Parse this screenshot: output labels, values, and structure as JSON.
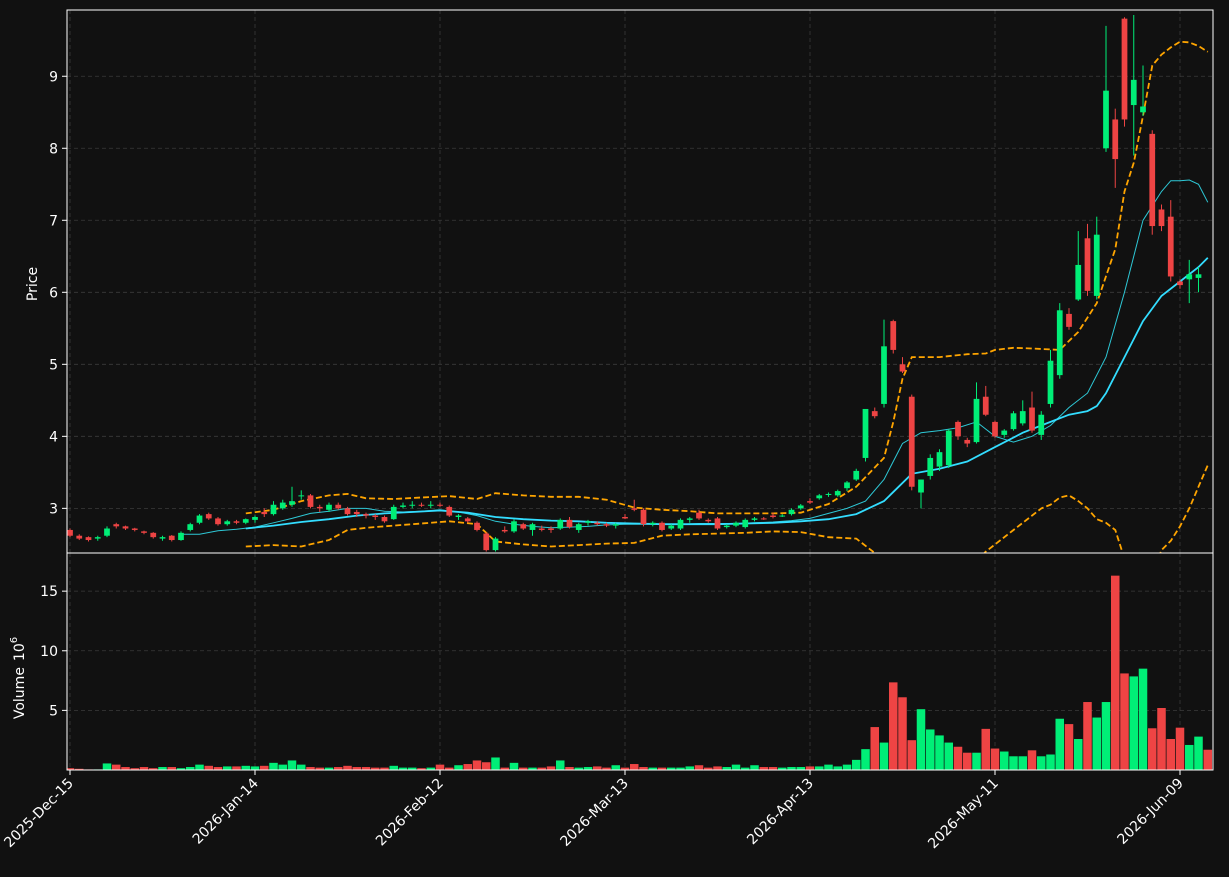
{
  "chart_data": {
    "type": "candlestick",
    "background": "#111111",
    "colors": {
      "up": "#00ee77",
      "down": "#ee4444",
      "ma_fast": "#2ec8d6",
      "ma_slow": "#33ddff",
      "bands": "#ffa500",
      "grid": "#3a3a3a",
      "axis": "#ffffff"
    },
    "grid": true,
    "price_panel": {
      "ylabel": "Price",
      "ylim": [
        2.38,
        9.92
      ],
      "yticks": [
        3,
        4,
        5,
        6,
        7,
        8,
        9
      ]
    },
    "volume_panel": {
      "ylabel": "Volume",
      "ylabel_exp": "10",
      "ylabel_sup": "6",
      "ylim": [
        0,
        18.2
      ],
      "yticks": [
        5,
        10,
        15
      ]
    },
    "x_ticks": [
      {
        "index": 0,
        "label": "2025-Dec-15"
      },
      {
        "index": 20,
        "label": "2026-Jan-14"
      },
      {
        "index": 40,
        "label": "2026-Feb-12"
      },
      {
        "index": 60,
        "label": "2026-Mar-13"
      },
      {
        "index": 80,
        "label": "2026-Apr-13"
      },
      {
        "index": 100,
        "label": "2026-May-11"
      },
      {
        "index": 120,
        "label": "2026-Jun-09"
      }
    ],
    "candles": [
      [
        2.7,
        2.72,
        2.6,
        2.62
      ],
      [
        2.62,
        2.64,
        2.56,
        2.58
      ],
      [
        2.6,
        2.61,
        2.54,
        2.56
      ],
      [
        2.58,
        2.62,
        2.55,
        2.6
      ],
      [
        2.62,
        2.75,
        2.6,
        2.72
      ],
      [
        2.78,
        2.8,
        2.72,
        2.75
      ],
      [
        2.75,
        2.76,
        2.7,
        2.72
      ],
      [
        2.72,
        2.73,
        2.68,
        2.7
      ],
      [
        2.68,
        2.69,
        2.64,
        2.66
      ],
      [
        2.66,
        2.67,
        2.58,
        2.6
      ],
      [
        2.58,
        2.62,
        2.55,
        2.6
      ],
      [
        2.62,
        2.63,
        2.54,
        2.56
      ],
      [
        2.56,
        2.68,
        2.55,
        2.66
      ],
      [
        2.7,
        2.8,
        2.68,
        2.78
      ],
      [
        2.8,
        2.92,
        2.78,
        2.9
      ],
      [
        2.92,
        2.94,
        2.84,
        2.86
      ],
      [
        2.86,
        2.88,
        2.76,
        2.78
      ],
      [
        2.78,
        2.84,
        2.76,
        2.82
      ],
      [
        2.82,
        2.84,
        2.78,
        2.8
      ],
      [
        2.8,
        2.86,
        2.78,
        2.85
      ],
      [
        2.84,
        2.9,
        2.8,
        2.88
      ],
      [
        2.95,
        3.0,
        2.88,
        2.92
      ],
      [
        2.92,
        3.1,
        2.9,
        3.05
      ],
      [
        3.0,
        3.12,
        2.98,
        3.08
      ],
      [
        3.05,
        3.3,
        3.02,
        3.1
      ],
      [
        3.18,
        3.25,
        3.12,
        3.18
      ],
      [
        3.18,
        3.2,
        3.0,
        3.02
      ],
      [
        3.02,
        3.05,
        2.95,
        3.0
      ],
      [
        2.98,
        3.08,
        2.95,
        3.05
      ],
      [
        3.05,
        3.08,
        2.98,
        3.0
      ],
      [
        3.0,
        3.02,
        2.9,
        2.92
      ],
      [
        2.95,
        2.98,
        2.88,
        2.92
      ],
      [
        2.92,
        2.94,
        2.86,
        2.9
      ],
      [
        2.9,
        2.92,
        2.84,
        2.88
      ],
      [
        2.88,
        2.9,
        2.8,
        2.82
      ],
      [
        2.85,
        3.05,
        2.84,
        3.02
      ],
      [
        3.02,
        3.08,
        3.0,
        3.04
      ],
      [
        3.04,
        3.1,
        3.0,
        3.05
      ],
      [
        3.05,
        3.08,
        3.02,
        3.04
      ],
      [
        3.04,
        3.1,
        3.0,
        3.05
      ],
      [
        3.05,
        3.08,
        3.02,
        3.04
      ],
      [
        3.02,
        3.04,
        2.88,
        2.9
      ],
      [
        2.88,
        2.92,
        2.84,
        2.9
      ],
      [
        2.86,
        2.88,
        2.8,
        2.82
      ],
      [
        2.8,
        2.82,
        2.68,
        2.7
      ],
      [
        2.65,
        2.67,
        2.4,
        2.42
      ],
      [
        2.42,
        2.6,
        2.4,
        2.58
      ],
      [
        2.7,
        2.75,
        2.66,
        2.68
      ],
      [
        2.68,
        2.85,
        2.66,
        2.82
      ],
      [
        2.78,
        2.8,
        2.7,
        2.72
      ],
      [
        2.7,
        2.8,
        2.62,
        2.78
      ],
      [
        2.72,
        2.76,
        2.68,
        2.7
      ],
      [
        2.72,
        2.75,
        2.66,
        2.7
      ],
      [
        2.72,
        2.86,
        2.7,
        2.84
      ],
      [
        2.84,
        2.88,
        2.72,
        2.74
      ],
      [
        2.7,
        2.8,
        2.66,
        2.78
      ],
      [
        2.8,
        2.84,
        2.76,
        2.82
      ],
      [
        2.8,
        2.82,
        2.76,
        2.78
      ],
      [
        2.78,
        2.8,
        2.74,
        2.76
      ],
      [
        2.76,
        2.8,
        2.72,
        2.78
      ],
      [
        2.88,
        2.92,
        2.85,
        2.86
      ],
      [
        3.0,
        3.12,
        2.96,
        2.98
      ],
      [
        2.98,
        3.0,
        2.75,
        2.78
      ],
      [
        2.78,
        2.82,
        2.75,
        2.8
      ],
      [
        2.8,
        2.82,
        2.68,
        2.7
      ],
      [
        2.72,
        2.78,
        2.7,
        2.76
      ],
      [
        2.72,
        2.86,
        2.7,
        2.84
      ],
      [
        2.84,
        2.88,
        2.8,
        2.86
      ],
      [
        2.94,
        2.98,
        2.84,
        2.86
      ],
      [
        2.84,
        2.86,
        2.8,
        2.82
      ],
      [
        2.86,
        2.88,
        2.7,
        2.72
      ],
      [
        2.74,
        2.78,
        2.72,
        2.76
      ],
      [
        2.76,
        2.82,
        2.74,
        2.8
      ],
      [
        2.74,
        2.86,
        2.72,
        2.84
      ],
      [
        2.84,
        2.88,
        2.82,
        2.86
      ],
      [
        2.86,
        2.88,
        2.84,
        2.85
      ],
      [
        2.9,
        2.94,
        2.86,
        2.88
      ],
      [
        2.9,
        2.92,
        2.88,
        2.9
      ],
      [
        2.92,
        3.0,
        2.9,
        2.98
      ],
      [
        3.0,
        3.06,
        2.98,
        3.04
      ],
      [
        3.1,
        3.14,
        3.06,
        3.08
      ],
      [
        3.14,
        3.2,
        3.12,
        3.18
      ],
      [
        3.2,
        3.22,
        3.16,
        3.2
      ],
      [
        3.18,
        3.26,
        3.16,
        3.24
      ],
      [
        3.28,
        3.38,
        3.24,
        3.36
      ],
      [
        3.4,
        3.55,
        3.38,
        3.52
      ],
      [
        3.7,
        4.38,
        3.65,
        4.38
      ],
      [
        4.35,
        4.4,
        4.25,
        4.28
      ],
      [
        4.45,
        5.62,
        4.4,
        5.25
      ],
      [
        5.6,
        5.62,
        5.15,
        5.2
      ],
      [
        5.0,
        5.1,
        4.88,
        4.9
      ],
      [
        4.55,
        4.58,
        3.25,
        3.3
      ],
      [
        3.22,
        3.4,
        3.0,
        3.4
      ],
      [
        3.45,
        3.75,
        3.4,
        3.7
      ],
      [
        3.58,
        3.82,
        3.52,
        3.78
      ],
      [
        3.6,
        4.1,
        3.56,
        4.08
      ],
      [
        4.2,
        4.22,
        3.95,
        4.0
      ],
      [
        3.95,
        3.98,
        3.85,
        3.9
      ],
      [
        3.92,
        4.75,
        3.9,
        4.52
      ],
      [
        4.55,
        4.7,
        4.28,
        4.3
      ],
      [
        4.2,
        4.22,
        3.98,
        4.0
      ],
      [
        4.02,
        4.1,
        3.98,
        4.08
      ],
      [
        4.1,
        4.35,
        4.08,
        4.32
      ],
      [
        4.18,
        4.5,
        4.15,
        4.35
      ],
      [
        4.4,
        4.62,
        4.05,
        4.08
      ],
      [
        4.02,
        4.35,
        3.95,
        4.3
      ],
      [
        4.45,
        5.2,
        4.4,
        5.05
      ],
      [
        4.85,
        5.85,
        4.8,
        5.75
      ],
      [
        5.7,
        5.78,
        5.48,
        5.52
      ],
      [
        5.9,
        6.85,
        5.88,
        6.38
      ],
      [
        6.75,
        6.95,
        5.95,
        6.02
      ],
      [
        5.95,
        7.05,
        5.9,
        6.8
      ],
      [
        8.0,
        9.7,
        7.95,
        8.8
      ],
      [
        8.4,
        8.55,
        7.45,
        7.85
      ],
      [
        9.8,
        9.82,
        8.3,
        8.4
      ],
      [
        8.6,
        9.85,
        7.9,
        8.95
      ],
      [
        8.5,
        9.15,
        8.45,
        8.58
      ],
      [
        8.2,
        8.25,
        6.8,
        6.92
      ],
      [
        7.15,
        7.22,
        6.85,
        6.92
      ],
      [
        7.05,
        7.28,
        6.15,
        6.22
      ],
      [
        6.15,
        6.18,
        6.05,
        6.1
      ],
      [
        6.18,
        6.45,
        5.85,
        6.25
      ],
      [
        6.2,
        6.35,
        6.0,
        6.25
      ]
    ],
    "volume": [
      0.15,
      0.1,
      0.05,
      0.05,
      0.55,
      0.45,
      0.25,
      0.15,
      0.25,
      0.15,
      0.25,
      0.25,
      0.15,
      0.25,
      0.45,
      0.35,
      0.25,
      0.3,
      0.3,
      0.35,
      0.3,
      0.35,
      0.6,
      0.45,
      0.8,
      0.45,
      0.25,
      0.2,
      0.2,
      0.25,
      0.35,
      0.25,
      0.25,
      0.2,
      0.2,
      0.35,
      0.2,
      0.2,
      0.15,
      0.2,
      0.45,
      0.2,
      0.4,
      0.5,
      0.8,
      0.65,
      1.05,
      0.2,
      0.6,
      0.2,
      0.2,
      0.2,
      0.3,
      0.8,
      0.25,
      0.2,
      0.25,
      0.3,
      0.2,
      0.4,
      0.2,
      0.5,
      0.25,
      0.2,
      0.2,
      0.2,
      0.2,
      0.3,
      0.4,
      0.2,
      0.3,
      0.25,
      0.45,
      0.2,
      0.4,
      0.25,
      0.25,
      0.2,
      0.25,
      0.25,
      0.3,
      0.3,
      0.45,
      0.3,
      0.45,
      0.85,
      1.75,
      3.6,
      2.3,
      7.35,
      6.1,
      2.5,
      5.1,
      3.4,
      2.9,
      2.3,
      1.95,
      1.45,
      1.45,
      3.45,
      1.8,
      1.55,
      1.15,
      1.15,
      1.65,
      1.15,
      1.3,
      4.3,
      3.85,
      2.6,
      5.7,
      4.4,
      5.7,
      16.3,
      8.1,
      7.85,
      8.5,
      3.5,
      5.2,
      2.6,
      3.55,
      2.1,
      2.8,
      1.7
    ],
    "ma_fast": [
      [
        12,
        2.64
      ],
      [
        14,
        2.64
      ],
      [
        16,
        2.69
      ],
      [
        18,
        2.71
      ],
      [
        20,
        2.74
      ],
      [
        22,
        2.8
      ],
      [
        24,
        2.86
      ],
      [
        26,
        2.93
      ],
      [
        28,
        2.96
      ],
      [
        30,
        3.0
      ],
      [
        32,
        3.0
      ],
      [
        34,
        2.96
      ],
      [
        36,
        2.95
      ],
      [
        38,
        2.96
      ],
      [
        40,
        2.98
      ],
      [
        42,
        2.95
      ],
      [
        44,
        2.9
      ],
      [
        46,
        2.82
      ],
      [
        48,
        2.78
      ],
      [
        50,
        2.75
      ],
      [
        52,
        2.73
      ],
      [
        54,
        2.74
      ],
      [
        56,
        2.75
      ],
      [
        58,
        2.77
      ],
      [
        60,
        2.78
      ],
      [
        62,
        2.78
      ],
      [
        64,
        2.78
      ],
      [
        66,
        2.78
      ],
      [
        68,
        2.79
      ],
      [
        70,
        2.79
      ],
      [
        72,
        2.79
      ],
      [
        74,
        2.8
      ],
      [
        76,
        2.81
      ],
      [
        78,
        2.83
      ],
      [
        80,
        2.86
      ],
      [
        82,
        2.93
      ],
      [
        84,
        3.0
      ],
      [
        86,
        3.1
      ],
      [
        88,
        3.4
      ],
      [
        90,
        3.9
      ],
      [
        92,
        4.05
      ],
      [
        94,
        4.08
      ],
      [
        96,
        4.12
      ],
      [
        98,
        4.2
      ],
      [
        100,
        4.0
      ],
      [
        102,
        3.92
      ],
      [
        104,
        4.0
      ],
      [
        106,
        4.15
      ],
      [
        108,
        4.4
      ],
      [
        110,
        4.6
      ],
      [
        112,
        5.1
      ],
      [
        114,
        6.0
      ],
      [
        116,
        7.0
      ],
      [
        118,
        7.4
      ],
      [
        119,
        7.55
      ],
      [
        120,
        7.55
      ],
      [
        121,
        7.56
      ],
      [
        122,
        7.5
      ],
      [
        123,
        7.25
      ]
    ],
    "ma_slow": [
      [
        19,
        2.72
      ],
      [
        22,
        2.76
      ],
      [
        25,
        2.81
      ],
      [
        28,
        2.85
      ],
      [
        31,
        2.9
      ],
      [
        34,
        2.93
      ],
      [
        37,
        2.95
      ],
      [
        40,
        2.97
      ],
      [
        43,
        2.94
      ],
      [
        46,
        2.88
      ],
      [
        49,
        2.85
      ],
      [
        52,
        2.83
      ],
      [
        55,
        2.82
      ],
      [
        58,
        2.8
      ],
      [
        61,
        2.79
      ],
      [
        64,
        2.78
      ],
      [
        67,
        2.78
      ],
      [
        70,
        2.78
      ],
      [
        73,
        2.79
      ],
      [
        76,
        2.8
      ],
      [
        79,
        2.82
      ],
      [
        82,
        2.85
      ],
      [
        85,
        2.92
      ],
      [
        88,
        3.1
      ],
      [
        91,
        3.48
      ],
      [
        94,
        3.55
      ],
      [
        97,
        3.65
      ],
      [
        100,
        3.85
      ],
      [
        103,
        4.05
      ],
      [
        106,
        4.2
      ],
      [
        108,
        4.3
      ],
      [
        110,
        4.35
      ],
      [
        111,
        4.42
      ],
      [
        112,
        4.6
      ],
      [
        114,
        5.1
      ],
      [
        116,
        5.6
      ],
      [
        118,
        5.95
      ],
      [
        120,
        6.15
      ],
      [
        122,
        6.35
      ],
      [
        123,
        6.48
      ]
    ],
    "band_upper": [
      [
        19,
        2.93
      ],
      [
        22,
        2.98
      ],
      [
        25,
        3.1
      ],
      [
        28,
        3.18
      ],
      [
        30,
        3.2
      ],
      [
        32,
        3.14
      ],
      [
        35,
        3.13
      ],
      [
        38,
        3.15
      ],
      [
        41,
        3.17
      ],
      [
        44,
        3.13
      ],
      [
        46,
        3.21
      ],
      [
        49,
        3.18
      ],
      [
        52,
        3.16
      ],
      [
        55,
        3.16
      ],
      [
        58,
        3.12
      ],
      [
        61,
        3.01
      ],
      [
        64,
        2.98
      ],
      [
        67,
        2.96
      ],
      [
        70,
        2.93
      ],
      [
        73,
        2.93
      ],
      [
        76,
        2.93
      ],
      [
        79,
        2.94
      ],
      [
        82,
        3.06
      ],
      [
        85,
        3.3
      ],
      [
        88,
        3.7
      ],
      [
        89,
        4.2
      ],
      [
        90,
        4.8
      ],
      [
        91,
        5.1
      ],
      [
        94,
        5.1
      ],
      [
        97,
        5.14
      ],
      [
        99,
        5.15
      ],
      [
        100,
        5.2
      ],
      [
        102,
        5.23
      ],
      [
        104,
        5.22
      ],
      [
        107,
        5.2
      ],
      [
        109,
        5.45
      ],
      [
        111,
        5.85
      ],
      [
        113,
        6.6
      ],
      [
        114,
        7.4
      ],
      [
        115,
        7.8
      ],
      [
        116,
        8.45
      ],
      [
        117,
        9.15
      ],
      [
        118,
        9.3
      ],
      [
        119,
        9.4
      ],
      [
        120,
        9.48
      ],
      [
        121,
        9.47
      ],
      [
        122,
        9.42
      ],
      [
        123,
        9.34
      ]
    ],
    "band_lower": [
      [
        19,
        2.47
      ],
      [
        22,
        2.49
      ],
      [
        25,
        2.47
      ],
      [
        28,
        2.56
      ],
      [
        30,
        2.7
      ],
      [
        32,
        2.73
      ],
      [
        35,
        2.76
      ],
      [
        38,
        2.79
      ],
      [
        41,
        2.82
      ],
      [
        44,
        2.78
      ],
      [
        46,
        2.54
      ],
      [
        49,
        2.5
      ],
      [
        52,
        2.47
      ],
      [
        55,
        2.49
      ],
      [
        58,
        2.51
      ],
      [
        61,
        2.52
      ],
      [
        64,
        2.62
      ],
      [
        67,
        2.64
      ],
      [
        70,
        2.65
      ],
      [
        73,
        2.66
      ],
      [
        76,
        2.68
      ],
      [
        79,
        2.67
      ],
      [
        82,
        2.6
      ],
      [
        85,
        2.58
      ],
      [
        86,
        2.48
      ],
      [
        87,
        2.38
      ],
      [
        90,
        1.9
      ],
      [
        93,
        1.7
      ],
      [
        96,
        2.0
      ],
      [
        99,
        2.4
      ],
      [
        102,
        2.7
      ],
      [
        105,
        3.0
      ],
      [
        106,
        3.05
      ],
      [
        107,
        3.15
      ],
      [
        108,
        3.18
      ],
      [
        109,
        3.1
      ],
      [
        110,
        3.0
      ],
      [
        111,
        2.85
      ],
      [
        112,
        2.8
      ],
      [
        113,
        2.7
      ],
      [
        114,
        2.3
      ],
      [
        116,
        1.85
      ],
      [
        117,
        2.1
      ],
      [
        118,
        2.42
      ],
      [
        119,
        2.55
      ],
      [
        120,
        2.75
      ],
      [
        121,
        3.0
      ],
      [
        122,
        3.3
      ],
      [
        123,
        3.6
      ]
    ]
  }
}
